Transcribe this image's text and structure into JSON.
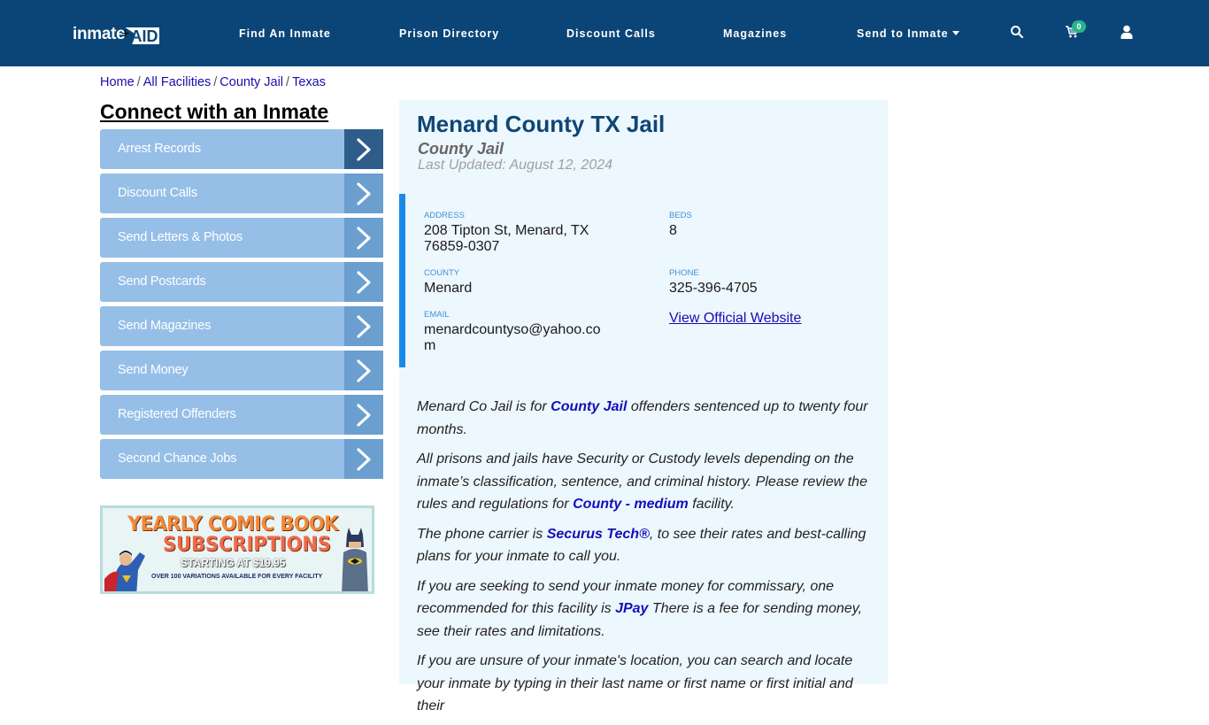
{
  "header": {
    "logo": {
      "text_main": "inmate",
      "text_accent": "AID",
      "plus": "+"
    },
    "nav": [
      {
        "label": "Find An Inmate"
      },
      {
        "label": "Prison Directory"
      },
      {
        "label": "Discount Calls"
      },
      {
        "label": "Magazines"
      },
      {
        "label": "Send to Inmate",
        "has_dropdown": true
      }
    ],
    "icons": {
      "search": "search-icon",
      "cart": "cart-icon",
      "user": "user-icon"
    },
    "cart_count": "0",
    "colors": {
      "bar": "#0b4577",
      "badge": "#2bb38a"
    }
  },
  "breadcrumb": [
    {
      "label": "Home"
    },
    {
      "label": "All Facilities"
    },
    {
      "label": "County Jail"
    },
    {
      "label": "Texas"
    }
  ],
  "sidebar": {
    "title": "Connect with an Inmate",
    "items": [
      {
        "label": "Arrest Records"
      },
      {
        "label": "Discount Calls"
      },
      {
        "label": "Send Letters & Photos"
      },
      {
        "label": "Send Postcards"
      },
      {
        "label": "Send Magazines"
      },
      {
        "label": "Send Money"
      },
      {
        "label": "Registered Offenders"
      },
      {
        "label": "Second Chance Jobs"
      }
    ],
    "ad": {
      "line1": "YEARLY COMIC BOOK",
      "line2": "SUBSCRIPTIONS",
      "line3": "STARTING AT $19.95",
      "line4": "OVER 100 VARIATIONS AVAILABLE FOR EVERY FACILITY"
    }
  },
  "facility": {
    "name": "Menard County TX Jail",
    "type": "County Jail",
    "last_updated": "Last Updated: August 12, 2024",
    "address_label": "ADDRESS",
    "address_line1": "208 Tipton St, Menard, TX",
    "address_line2": "76859-0307",
    "beds_label": "BEDS",
    "beds": "8",
    "county_label": "COUNTY",
    "county": "Menard",
    "phone_label": "PHONE",
    "phone": "325-396-4705",
    "email_label": "EMAIL",
    "email_line1": "menardcountyso@yahoo.co",
    "email_line2": "m",
    "website_link": "View Official Website"
  },
  "description": {
    "p1": {
      "a": "Menard Co Jail is for ",
      "link": "County Jail",
      "b": " offenders sentenced up to twenty four months."
    },
    "p2": {
      "a": "All prisons and jails have Security or Custody levels depending on the inmate’s classification, sentence, and criminal history. Please review the rules and regulations for ",
      "link": "County - medium",
      "b": " facility."
    },
    "p3": {
      "a": "The phone carrier is ",
      "link": "Securus Tech®",
      "b": ", to see their rates and best-calling plans for your inmate to call you."
    },
    "p4": {
      "a": "If you are seeking to send your inmate money for commissary, one recommended for this facility is ",
      "link": "JPay",
      "b": " There is a fee for sending money, see their rates and limitations."
    },
    "p5": {
      "a": "If you are unsure of your inmate's location, you can search and locate your inmate by typing in their last name or first name or first initial and their"
    }
  }
}
